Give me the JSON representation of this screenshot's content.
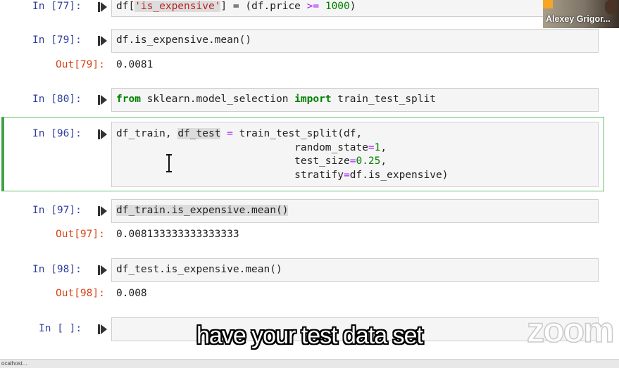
{
  "cells": [
    {
      "prompt": "In [77]:",
      "code_parts": [
        "df[",
        "'is_expensive'",
        "] = (df.price ",
        ">=",
        " ",
        "1000",
        ")"
      ]
    },
    {
      "prompt": "In [79]:",
      "code": "df.is_expensive.mean()",
      "out_prompt": "Out[79]:",
      "output": "0.0081"
    },
    {
      "prompt": "In [80]:",
      "code_parts": [
        "from",
        " sklearn.model_selection ",
        "import",
        " train_test_split"
      ]
    },
    {
      "prompt": "In [96]:",
      "lines": [
        [
          "df_train",
          ", ",
          "df_test",
          " ",
          "=",
          " train_test_split(df,"
        ],
        [
          "                             random_state",
          "=",
          "1",
          ","
        ],
        [
          "                             test_size",
          "=",
          "0.25",
          ","
        ],
        [
          "                             stratify",
          "=",
          "df.is_expensive)"
        ]
      ]
    },
    {
      "prompt": "In [97]:",
      "code": "df_train.is_expensive.mean()",
      "out_prompt": "Out[97]:",
      "output": "0.008133333333333333"
    },
    {
      "prompt": "In [98]:",
      "code": "df_test.is_expensive.mean()",
      "out_prompt": "Out[98]:",
      "output": "0.008"
    },
    {
      "prompt": "In [ ]:",
      "code": ""
    }
  ],
  "video": {
    "participant_name": "Alexey Grigor..."
  },
  "subtitle": "have your test data set",
  "watermark": "zoom",
  "status_bar": {
    "text": "ocalhost..."
  },
  "icons": {
    "run": "run-cell-icon"
  },
  "colors": {
    "selected_border": "#43a047",
    "in_prompt": "#303f9f",
    "out_prompt": "#d84315"
  }
}
